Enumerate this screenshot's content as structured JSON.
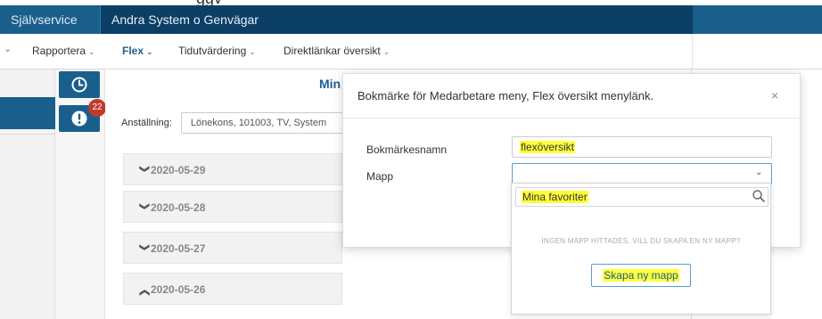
{
  "top_strip": {
    "partial_text": "ggv"
  },
  "topbar": {
    "items": [
      {
        "label": "Självservice"
      },
      {
        "label": "Andra System o Genvägar"
      }
    ]
  },
  "subnav": {
    "lead": "⌄",
    "items": [
      {
        "label": "Rapportera"
      },
      {
        "label": "Flex"
      },
      {
        "label": "Tidutvärdering"
      },
      {
        "label": "Direktlänkar översikt"
      }
    ]
  },
  "icons": {
    "clock": "clock-icon",
    "alert": "alert-icon",
    "badge_count": "22"
  },
  "main": {
    "heading": "Min",
    "employment_label": "Anställning:",
    "employment_value": "Lönekons, 101003, TV, System",
    "dates": [
      {
        "chevron": "down",
        "date": "2020-05-29"
      },
      {
        "chevron": "down",
        "date": "2020-05-28"
      },
      {
        "chevron": "down",
        "date": "2020-05-27"
      },
      {
        "chevron": "up",
        "date": "2020-05-26"
      }
    ]
  },
  "modal": {
    "title": "Bokmärke för Medarbetare meny, Flex översikt menylänk.",
    "close": "×",
    "name_label": "Bokmärkesnamn",
    "name_value": "flexöversikt",
    "folder_label": "Mapp",
    "folder_value": ""
  },
  "dropdown": {
    "search_value": "Mina favoriter",
    "message": "INGEN MAPP HITTADES. VILL DU SKAPA EN NY MAPP?",
    "create_label": "Skapa ny mapp"
  },
  "colors": {
    "brand": "#1a5f8c",
    "highlight": "#ffff3c",
    "badge": "#c0392b"
  }
}
